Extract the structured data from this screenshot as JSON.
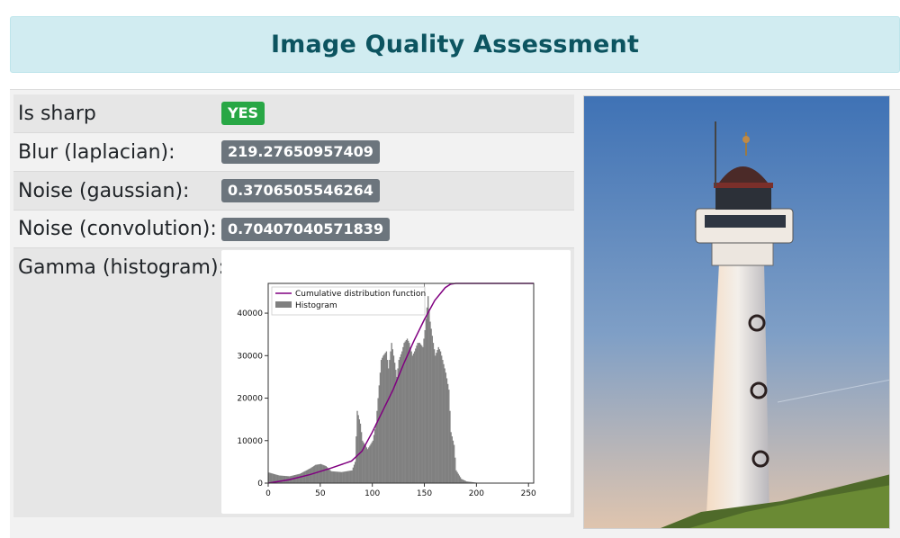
{
  "header": {
    "title": "Image Quality Assessment"
  },
  "rows": [
    {
      "label": "Is sharp",
      "value": "YES"
    },
    {
      "label": "Blur (laplacian):",
      "value": "219.27650957409"
    },
    {
      "label": "Noise (gaussian):",
      "value": "0.3706505546264"
    },
    {
      "label": "Noise (convolution):",
      "value": "0.70407040571839"
    }
  ],
  "gamma": {
    "label": "Gamma (histogram):"
  },
  "colors": {
    "yes_badge": "#28a745",
    "value_badge": "#6c757d",
    "header_bg": "#d1ecf1",
    "header_text": "#0c5460",
    "cdf_line": "#800080",
    "histogram": "#808080"
  },
  "chart_data": {
    "type": "bar",
    "legend": [
      "Cumulative distribution function",
      "Histogram"
    ],
    "legend_position": "top-left",
    "xlim": [
      0,
      255
    ],
    "ylim": [
      0,
      47000
    ],
    "xticks": [
      0,
      50,
      100,
      150,
      200,
      250
    ],
    "yticks": [
      0,
      10000,
      20000,
      30000,
      40000
    ],
    "xtick_labels": [
      "0",
      "50",
      "100",
      "150",
      "200",
      "250"
    ],
    "ytick_labels": [
      "0",
      "10000",
      "20000",
      "30000",
      "40000"
    ],
    "histogram": {
      "x": [
        0,
        10,
        20,
        30,
        40,
        45,
        50,
        55,
        60,
        70,
        80,
        83,
        85,
        88,
        90,
        95,
        100,
        103,
        105,
        108,
        110,
        113,
        115,
        118,
        120,
        123,
        125,
        128,
        130,
        133,
        135,
        138,
        140,
        143,
        145,
        148,
        150,
        153,
        155,
        158,
        160,
        163,
        165,
        168,
        170,
        173,
        175,
        178,
        180,
        185,
        190,
        200,
        210,
        255
      ],
      "values": [
        2500,
        1800,
        1600,
        2200,
        3500,
        4300,
        4500,
        4000,
        2800,
        2600,
        3000,
        5000,
        17000,
        14000,
        10000,
        8000,
        10000,
        14000,
        20000,
        29000,
        30000,
        31000,
        27000,
        33000,
        30000,
        25000,
        29000,
        31000,
        33000,
        34000,
        33000,
        30000,
        31000,
        33000,
        33000,
        32000,
        36000,
        44000,
        38000,
        33000,
        30000,
        32000,
        31000,
        28000,
        26000,
        22000,
        12000,
        9000,
        3000,
        1000,
        400,
        100,
        0,
        0
      ]
    },
    "cdf": {
      "x": [
        0,
        20,
        40,
        60,
        80,
        90,
        100,
        110,
        120,
        130,
        140,
        150,
        160,
        170,
        175,
        180,
        190,
        200,
        255
      ],
      "values": [
        0,
        800,
        2000,
        3500,
        5200,
        7500,
        12000,
        17000,
        22000,
        28000,
        33500,
        38500,
        43000,
        46000,
        46800,
        47000,
        47000,
        47000,
        47000
      ]
    }
  }
}
